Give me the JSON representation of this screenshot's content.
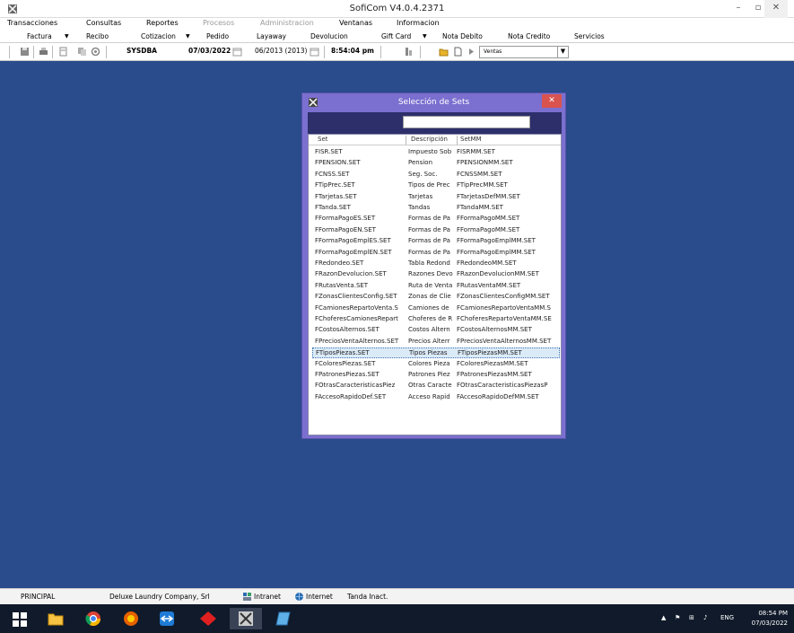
{
  "window": {
    "title": "SofiCom V4.0.4.2371",
    "minimize": "–",
    "restore": "▫",
    "close": "✕"
  },
  "menu": {
    "items": [
      "Transacciones",
      "Consultas",
      "Reportes",
      "Procesos",
      "Administracion",
      "Ventanas",
      "Informacion"
    ]
  },
  "submenu": {
    "items": [
      "Factura",
      "Recibo",
      "Cotizacion",
      "Pedido",
      "Layaway",
      "Devolucion",
      "Gift Card",
      "Nota Debito",
      "Nota Credito",
      "Servicios"
    ]
  },
  "toolbar": {
    "user": "SYSDBA",
    "date": "07/03/2022",
    "period": "06/2013 (2013)",
    "time": "8:54:04 pm",
    "combo_value": "Ventas"
  },
  "dialog": {
    "title": "Selección de Sets",
    "close": "✕",
    "columns": [
      "Set",
      "Descripción",
      "SetMM"
    ],
    "rows": [
      [
        "FISR.SET",
        "Impuesto Sob",
        "FISRMM.SET"
      ],
      [
        "FPENSION.SET",
        "Pension",
        "FPENSIONMM.SET"
      ],
      [
        "FCNSS.SET",
        "Seg. Soc.",
        "FCNSSMM.SET"
      ],
      [
        "FTipPrec.SET",
        "Tipos de Prec",
        "FTipPrecMM.SET"
      ],
      [
        "FTarjetas.SET",
        "Tarjetas",
        "FTarjetasDefMM.SET"
      ],
      [
        "FTanda.SET",
        "Tandas",
        "FTandaMM.SET"
      ],
      [
        "FFormaPagoES.SET",
        "Formas de Pa",
        "FFormaPagoMM.SET"
      ],
      [
        "FFormaPagoEN.SET",
        "Formas de Pa",
        "FFormaPagoMM.SET"
      ],
      [
        "FFormaPagoEmplES.SET",
        "Formas de Pa",
        "FFormaPagoEmplMM.SET"
      ],
      [
        "FFormaPagoEmplEN.SET",
        "Formas de Pa",
        "FFormaPagoEmplMM.SET"
      ],
      [
        "FRedondeo.SET",
        "Tabla Redond",
        "FRedondeoMM.SET"
      ],
      [
        "FRazonDevolucion.SET",
        "Razones Devo",
        "FRazonDevolucionMM.SET"
      ],
      [
        "FRutasVenta.SET",
        "Ruta de Venta",
        "FRutasVentaMM.SET"
      ],
      [
        "FZonasClientesConfig.SET",
        "Zonas de Clie",
        "FZonasClientesConfigMM.SET"
      ],
      [
        "FCamionesRepartoVenta.S",
        "Camiones de",
        "FCamionesRepartoVentaMM.S"
      ],
      [
        "FChoferesCamionesRepart",
        "Choferes de R",
        "FChoferesRepartoVentaMM.SE"
      ],
      [
        "FCostosAlternos.SET",
        "Costos Altern",
        "FCostosAlternosMM.SET"
      ],
      [
        "FPreciosVentaAlternos.SET",
        "Precios Alterr",
        "FPreciosVentaAlternosMM.SET"
      ],
      [
        "FTiposPiezas.SET",
        "Tipos Piezas",
        "FTiposPiezasMM.SET"
      ],
      [
        "FColoresPiezas.SET",
        "Colores Pieza",
        "FColoresPiezasMM.SET"
      ],
      [
        "FPatronesPiezas.SET",
        "Patrones Piez",
        "FPatronesPiezasMM.SET"
      ],
      [
        "FOtrasCaracteristicasPiez",
        "Otras Caracte",
        "FOtrasCaracteristicasPiezasP"
      ],
      [
        "FAccesoRapidoDef.SET",
        "Acceso Rapid",
        "FAccesoRapidoDefMM.SET"
      ]
    ],
    "selected_row": 18
  },
  "status": {
    "module": "PRINCIPAL",
    "company": "Deluxe Laundry Company, Srl",
    "intranet": "Intranet",
    "internet": "Internet",
    "tanda": "Tanda Inact."
  },
  "taskbar": {
    "language": "ENG",
    "time": "08:54 PM",
    "date": "07/03/2022"
  }
}
